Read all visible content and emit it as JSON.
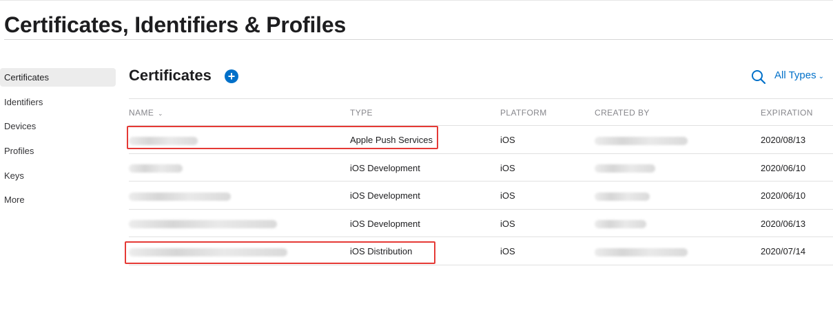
{
  "page": {
    "title": "Certificates, Identifiers & Profiles"
  },
  "sidebar": {
    "items": [
      {
        "label": "Certificates",
        "active": true
      },
      {
        "label": "Identifiers",
        "active": false
      },
      {
        "label": "Devices",
        "active": false
      },
      {
        "label": "Profiles",
        "active": false
      },
      {
        "label": "Keys",
        "active": false
      },
      {
        "label": "More",
        "active": false
      }
    ]
  },
  "main": {
    "section_title": "Certificates",
    "add_icon": "plus-circle-icon",
    "search_icon": "search-icon",
    "type_filter": {
      "label": "All Types",
      "chevron": "⌄"
    }
  },
  "table": {
    "columns": [
      {
        "label": "NAME",
        "sort_chevron": "⌄"
      },
      {
        "label": "TYPE"
      },
      {
        "label": "PLATFORM"
      },
      {
        "label": "CREATED BY"
      },
      {
        "label": "EXPIRATION"
      }
    ],
    "rows": [
      {
        "name": "",
        "type": "Apple Push Services",
        "platform": "iOS",
        "created_by": "",
        "expiration": "2020/08/13"
      },
      {
        "name": "",
        "type": "iOS Development",
        "platform": "iOS",
        "created_by": "",
        "expiration": "2020/06/10"
      },
      {
        "name": "",
        "type": "iOS Development",
        "platform": "iOS",
        "created_by": "",
        "expiration": "2020/06/10"
      },
      {
        "name": "",
        "type": "iOS Development",
        "platform": "iOS",
        "created_by": "",
        "expiration": "2020/06/13"
      },
      {
        "name": "",
        "type": "iOS Distribution",
        "platform": "iOS",
        "created_by": "",
        "expiration": "2020/07/14"
      }
    ]
  },
  "colors": {
    "accent": "#0070c9",
    "annotation": "#e53935",
    "sidebar_active_bg": "#ececec",
    "header_text": "#86868b"
  }
}
